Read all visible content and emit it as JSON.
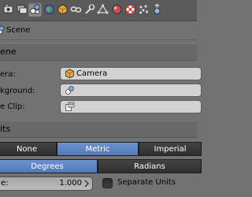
{
  "toolbar": {
    "tabs": [
      {
        "icon": "render-icon"
      },
      {
        "icon": "render-layers-icon"
      },
      {
        "icon": "scene-icon",
        "active": true
      },
      {
        "icon": "world-icon"
      },
      {
        "icon": "object-icon"
      },
      {
        "icon": "constraints-icon"
      },
      {
        "icon": "modifiers-icon"
      },
      {
        "icon": "object-data-icon"
      },
      {
        "icon": "material-icon"
      },
      {
        "icon": "texture-icon"
      },
      {
        "icon": "particles-icon"
      },
      {
        "icon": "physics-icon"
      }
    ]
  },
  "path": {
    "label": "Scene"
  },
  "scene_panel": {
    "title": "ene",
    "camera_label": "era:",
    "camera_value": "Camera",
    "background_label": "kground:",
    "background_value": "",
    "clip_label": "e Clip:",
    "clip_value": ""
  },
  "units_panel": {
    "title": "its",
    "systems": [
      "None",
      "Metric",
      "Imperial"
    ],
    "selected_system": "Metric",
    "rotation": [
      "Degrees",
      "Radians"
    ],
    "selected_rotation": "Degrees",
    "scale_label": "e:",
    "scale_value": "1.000",
    "separate_units_label": "Separate Units",
    "separate_units_checked": false
  },
  "colors": {
    "selected": "#5579b8",
    "panel_bg": "#727272",
    "header_bg": "#5a5a5a"
  }
}
